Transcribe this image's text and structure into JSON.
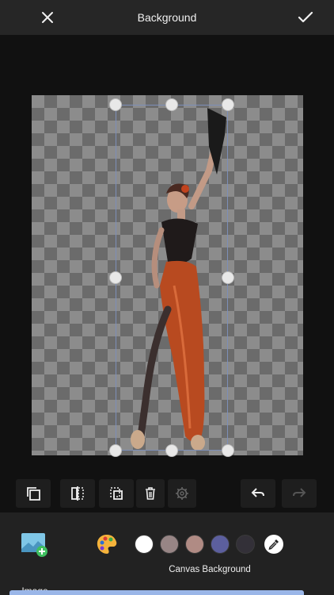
{
  "header": {
    "title": "Background",
    "close_icon": "close-icon",
    "confirm_icon": "checkmark-icon"
  },
  "toolbar": {
    "tools": [
      "layers-icon",
      "flip-horizontal-icon",
      "crop-select-icon",
      "trash-icon",
      "settings-gear-icon"
    ],
    "undo_icon": "undo-icon",
    "redo_icon": "redo-icon"
  },
  "bottom": {
    "image_label": "Image",
    "palette_icon": "palette-icon",
    "swatches": [
      "#ffffff",
      "#978585",
      "#b08b84",
      "#5c5f9e",
      "#333038"
    ],
    "picker_icon": "eyedropper-icon",
    "canvas_label": "Canvas Background"
  },
  "colors": {
    "topbar": "#262626",
    "background": "#111111",
    "selection_border": "#7d8fb8",
    "accent": "#9ab6e8"
  }
}
